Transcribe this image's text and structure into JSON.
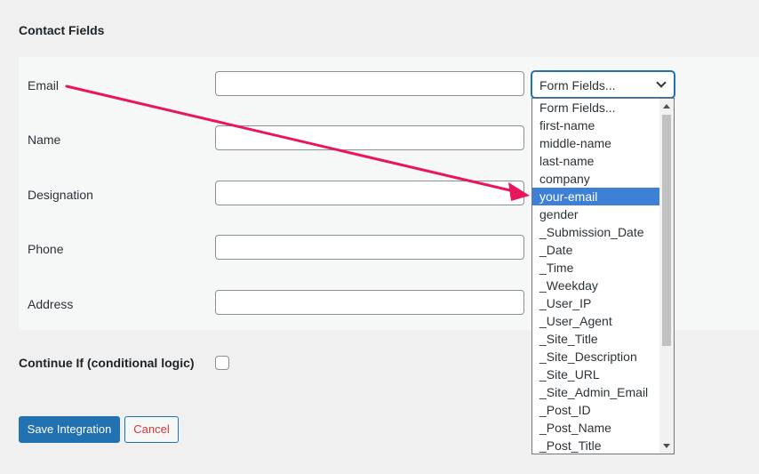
{
  "section": {
    "title": "Contact Fields"
  },
  "fields": [
    {
      "label": "Email",
      "value": ""
    },
    {
      "label": "Name",
      "value": ""
    },
    {
      "label": "Designation",
      "value": ""
    },
    {
      "label": "Phone",
      "value": ""
    },
    {
      "label": "Address",
      "value": ""
    }
  ],
  "select": {
    "value": "Form Fields...",
    "options": [
      "Form Fields...",
      "first-name",
      "middle-name",
      "last-name",
      "company",
      "your-email",
      "gender",
      "_Submission_Date",
      "_Date",
      "_Time",
      "_Weekday",
      "_User_IP",
      "_User_Agent",
      "_Site_Title",
      "_Site_Description",
      "_Site_URL",
      "_Site_Admin_Email",
      "_Post_ID",
      "_Post_Name",
      "_Post_Title"
    ],
    "highlighted": "your-email"
  },
  "conditional": {
    "label": "Continue If (conditional logic)",
    "checked": false
  },
  "buttons": {
    "save": "Save Integration",
    "cancel": "Cancel"
  },
  "colors": {
    "primary": "#2271b1",
    "cancel_text": "#d63638",
    "annotation_arrow": "#e8175d",
    "highlight": "#3d80d6"
  },
  "icons": {
    "select_arrow": "chevron-down-icon",
    "annotation": "arrow-annotation-icon"
  }
}
